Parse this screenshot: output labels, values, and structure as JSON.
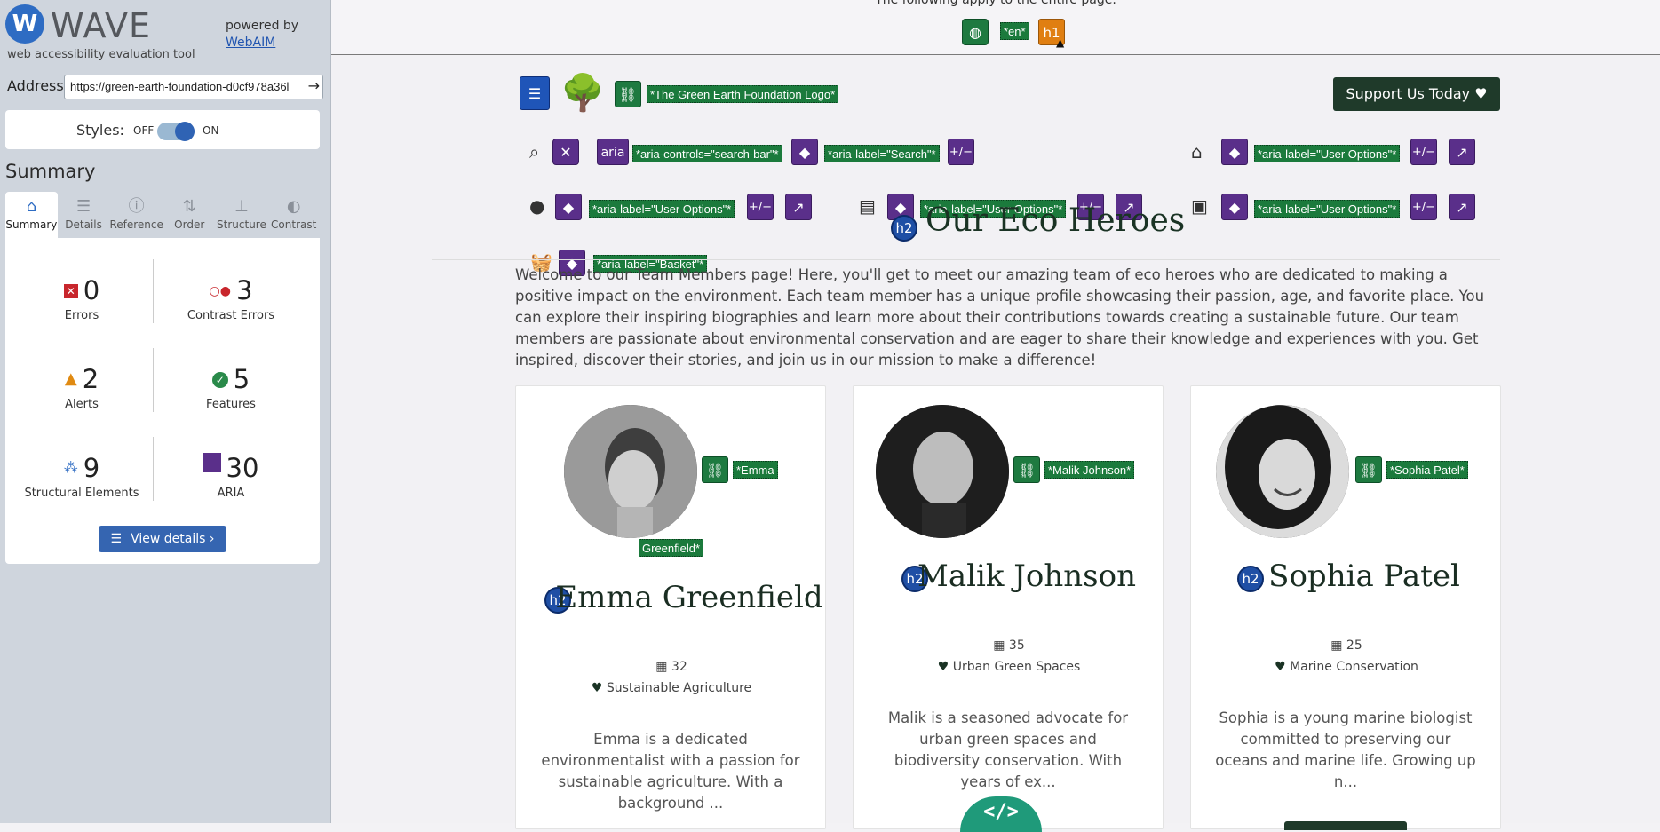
{
  "wave": {
    "logo_letter": "W",
    "title": "WAVE",
    "subtitle": "web accessibility evaluation tool",
    "powered_by": "powered by",
    "webaim": "WebAIM",
    "address_label": "Address:",
    "address_value": "https://green-earth-foundation-d0cf978a36l",
    "styles_label": "Styles:",
    "styles_off": "OFF",
    "styles_on": "ON",
    "summary_heading": "Summary",
    "tabs": [
      {
        "label": "Summary",
        "icon": "home-icon"
      },
      {
        "label": "Details",
        "icon": "list-icon"
      },
      {
        "label": "Reference",
        "icon": "info-icon"
      },
      {
        "label": "Order",
        "icon": "order-icon"
      },
      {
        "label": "Structure",
        "icon": "structure-icon"
      },
      {
        "label": "Contrast",
        "icon": "contrast-icon"
      }
    ],
    "stats": {
      "errors": {
        "count": "0",
        "label": "Errors"
      },
      "contrast": {
        "count": "3",
        "label": "Contrast Errors"
      },
      "alerts": {
        "count": "2",
        "label": "Alerts"
      },
      "features": {
        "count": "5",
        "label": "Features"
      },
      "structural": {
        "count": "9",
        "label": "Structural Elements"
      },
      "aria": {
        "count": "30",
        "label": "ARIA"
      }
    },
    "view_details": "View details ›",
    "colors": {
      "accent": "#2e6cc3",
      "sidebar_bg": "#cfd5dd"
    }
  },
  "page": {
    "top_note": "The following apply to the entire page.",
    "lang_label": "*en*",
    "h1_badge": "h1",
    "logo_alt_label": "*The Green Earth Foundation Logo*",
    "support_button": "Support Us Today ♥",
    "aria_chip": "aria",
    "labels": {
      "aria_controls": "*aria-controls=\"search-bar\"*",
      "aria_search": "*aria-label=\"Search\"*",
      "aria_user_options": "*aria-label=\"User Options\"*",
      "aria_basket": "*aria-label=\"Basket\"*",
      "plusminus": "+/−"
    },
    "h2_badge": "h2",
    "heading": "Our Eco Heroes",
    "intro": "Welcome to our Team Members page! Here, you'll get to meet our amazing team of eco heroes who are dedicated to making a positive impact on the environment. Each team member has a unique profile showcasing their passion, age, and favorite place. You can explore their inspiring biographies and learn more about their contributions towards creating a sustainable future. Our team members are passionate about environmental conservation and are eager to share their knowledge and experiences with you. Get inspired, discover their stories, and join us in our mission to make a difference!",
    "cards": [
      {
        "alt_label_1": "*Emma",
        "alt_label_2": "Greenfield*",
        "name": "Emma Greenfield",
        "age": "32",
        "place": "Sustainable Agriculture",
        "bio": "Emma is a dedicated environmentalist with a passion for sustainable agriculture. With a background ..."
      },
      {
        "alt_label_1": "*Malik Johnson*",
        "name": "Malik Johnson",
        "age": "35",
        "place": "Urban Green Spaces",
        "bio": "Malik is a seasoned advocate for urban green spaces and biodiversity conservation. With years of ex..."
      },
      {
        "alt_label_1": "*Sophia Patel*",
        "name": "Sophia Patel",
        "age": "25",
        "place": "Marine Conservation",
        "bio": "Sophia is a young marine biologist committed to preserving our oceans and marine life. Growing up n..."
      }
    ],
    "code_badge": "</>"
  }
}
